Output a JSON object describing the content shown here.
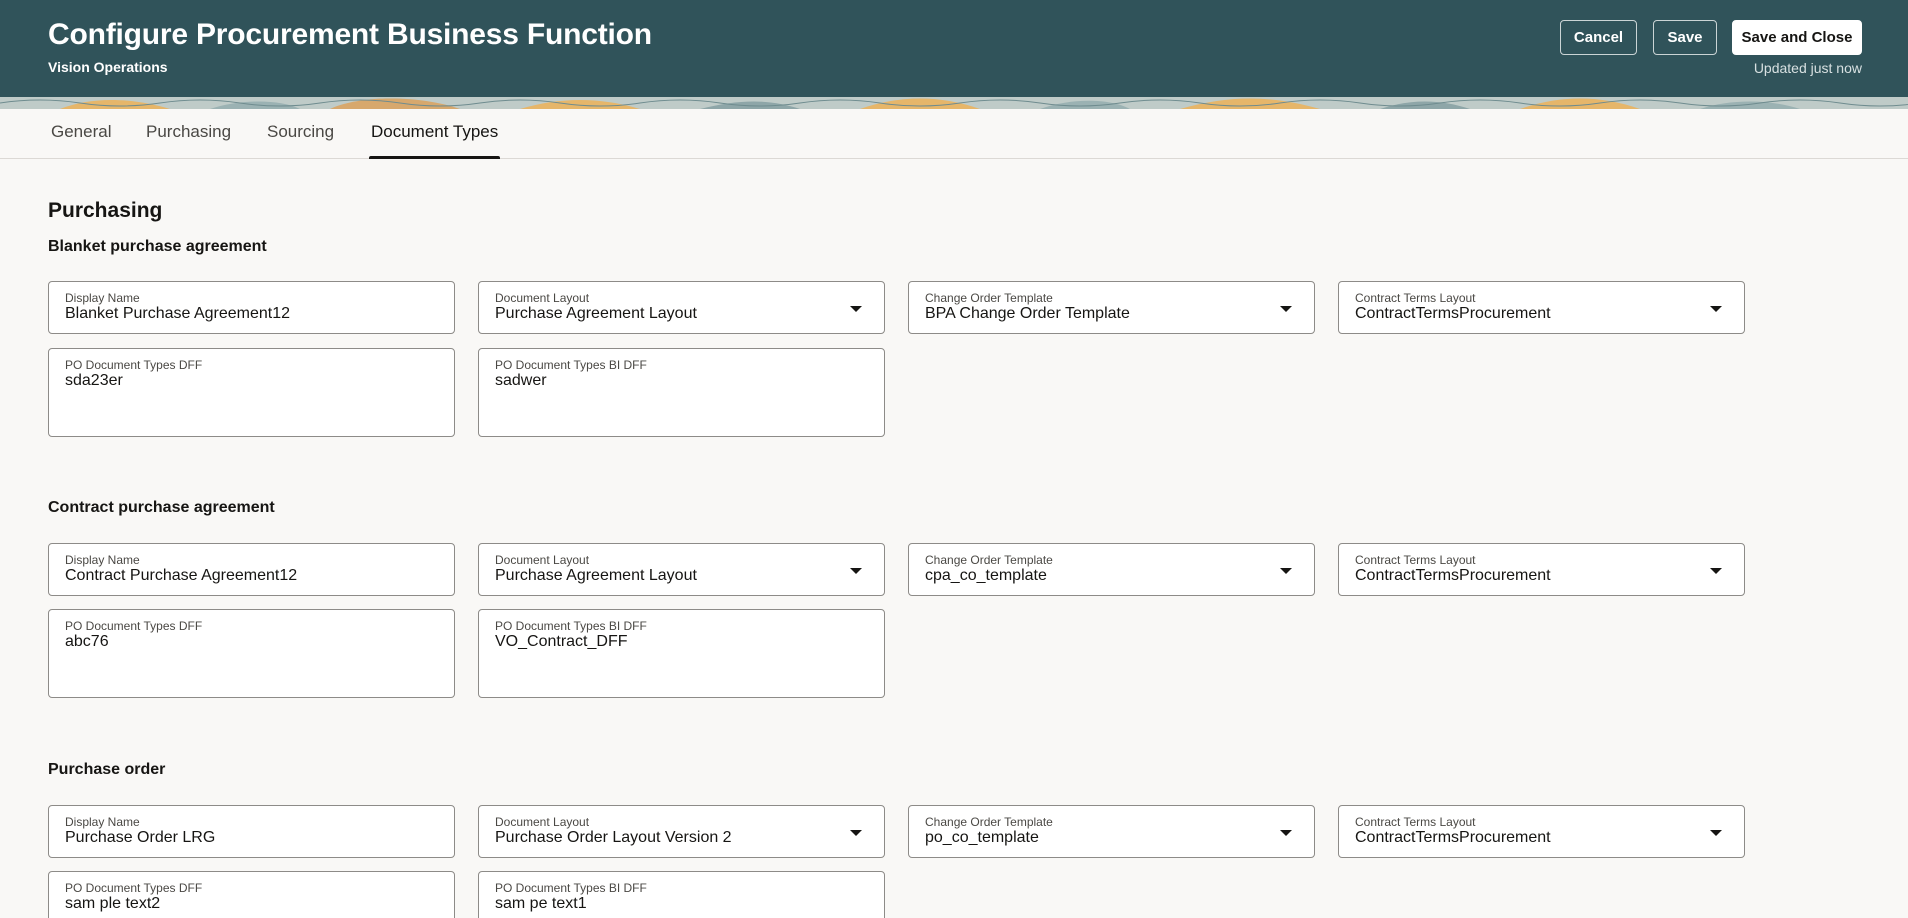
{
  "header": {
    "title": "Configure Procurement Business Function",
    "subtitle": "Vision Operations",
    "cancel_label": "Cancel",
    "save_label": "Save",
    "save_close_label": "Save and Close",
    "status": "Updated just now"
  },
  "tabs": [
    {
      "label": "General",
      "active": false
    },
    {
      "label": "Purchasing",
      "active": false
    },
    {
      "label": "Sourcing",
      "active": false
    },
    {
      "label": "Document Types",
      "active": true
    }
  ],
  "page": {
    "heading": "Purchasing"
  },
  "sections": [
    {
      "title": "Blanket purchase agreement",
      "display_name": {
        "label": "Display Name",
        "value": "Blanket Purchase Agreement12"
      },
      "document_layout": {
        "label": "Document Layout",
        "value": "Purchase Agreement Layout"
      },
      "change_order_template": {
        "label": "Change Order Template",
        "value": "BPA Change Order Template"
      },
      "contract_terms_layout": {
        "label": "Contract Terms Layout",
        "value": "ContractTermsProcurement"
      },
      "po_dff": {
        "label": "PO Document Types DFF",
        "value": "sda23er"
      },
      "po_bi_dff": {
        "label": "PO Document Types BI DFF",
        "value": "sadwer"
      }
    },
    {
      "title": "Contract purchase agreement",
      "display_name": {
        "label": "Display Name",
        "value": "Contract Purchase Agreement12"
      },
      "document_layout": {
        "label": "Document Layout",
        "value": "Purchase Agreement Layout"
      },
      "change_order_template": {
        "label": "Change Order Template",
        "value": "cpa_co_template"
      },
      "contract_terms_layout": {
        "label": "Contract Terms Layout",
        "value": "ContractTermsProcurement"
      },
      "po_dff": {
        "label": "PO Document Types DFF",
        "value": "abc76"
      },
      "po_bi_dff": {
        "label": "PO Document Types BI DFF",
        "value": "VO_Contract_DFF"
      }
    },
    {
      "title": "Purchase order",
      "display_name": {
        "label": "Display Name",
        "value": "Purchase Order LRG"
      },
      "document_layout": {
        "label": "Document Layout",
        "value": "Purchase Order Layout Version 2"
      },
      "change_order_template": {
        "label": "Change Order Template",
        "value": "po_co_template"
      },
      "contract_terms_layout": {
        "label": "Contract Terms Layout",
        "value": "ContractTermsProcurement"
      },
      "po_dff": {
        "label": "PO Document Types DFF",
        "value": "sam ple text2"
      },
      "po_bi_dff": {
        "label": "PO Document Types BI DFF",
        "value": "sam pe text1"
      }
    }
  ],
  "icons": {
    "dropdown": "chevron-down-icon"
  },
  "colors": {
    "header_bg": "#30535a",
    "page_bg": "#f9f8f6",
    "field_border": "#8d8b88"
  }
}
